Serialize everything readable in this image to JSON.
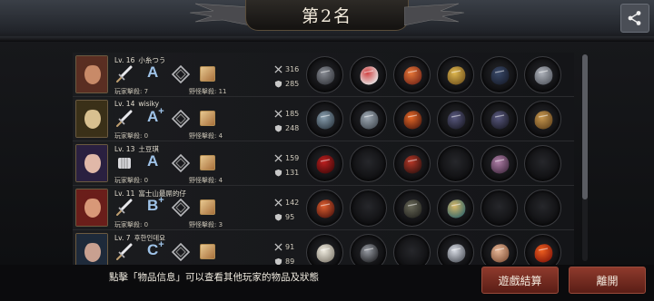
{
  "header": {
    "rank_title": "第2名"
  },
  "players": [
    {
      "level": "Lv. 16",
      "name": "小糸つう",
      "grade": "A",
      "grade_plus": "",
      "weapon_icon": "sword-icon",
      "pk_label": "玩家擊殺: 7",
      "mk_label": "野怪擊殺: 11",
      "atk": "316",
      "def": "285",
      "items": [
        "axe-item",
        "helmet-red-white-item",
        "flame-gauntlet-item",
        "gold-shield-item",
        "dark-boots-item",
        "claw-blades-item"
      ]
    },
    {
      "level": "Lv. 14",
      "name": "wisiky",
      "grade": "A",
      "grade_plus": "+",
      "weapon_icon": "sword-icon",
      "pk_label": "玩家擊殺: 0",
      "mk_label": "野怪擊殺: 4",
      "atk": "185",
      "def": "248",
      "items": [
        "gun-item",
        "steel-helmet-item",
        "fire-armor-item",
        "dark-gauntlet-item",
        "dark-gauntlet-item",
        "treasure-box-item"
      ]
    },
    {
      "level": "Lv. 13",
      "name": "土豆琪",
      "grade": "A",
      "grade_plus": "",
      "weapon_icon": "fist-icon",
      "pk_label": "玩家擊殺: 0",
      "mk_label": "野怪擊殺: 4",
      "atk": "159",
      "def": "131",
      "items": [
        "red-claw-item",
        "empty",
        "red-armor-item",
        "empty",
        "purple-boots-item",
        "empty"
      ]
    },
    {
      "level": "Lv. 11",
      "name": "富士山最屌的仔",
      "grade": "B",
      "grade_plus": "+",
      "weapon_icon": "sword-icon",
      "pk_label": "玩家擊殺: 0",
      "mk_label": "野怪擊殺: 3",
      "atk": "142",
      "def": "95",
      "items": [
        "fire-sword-item",
        "empty",
        "vest-item",
        "treasure-scroll-item",
        "empty",
        "empty"
      ]
    },
    {
      "level": "Lv. 7",
      "name": "후한인데요",
      "grade": "C",
      "grade_plus": "+",
      "weapon_icon": "sword-icon",
      "pk_label": "",
      "mk_label": "",
      "atk": "91",
      "def": "89",
      "items": [
        "white-helmet-item",
        "ring-item",
        "empty",
        "silver-disc-item",
        "arm-item",
        "fire-orb-item"
      ]
    }
  ],
  "footer": {
    "hint": "點擊「物品信息」可以查看其他玩家的物品及狀態",
    "end_button": "遊戲結算",
    "leave_button": "離開"
  },
  "colors": {
    "button_red": "#8e3a2c",
    "grade_blue": "#9fc3e8"
  }
}
